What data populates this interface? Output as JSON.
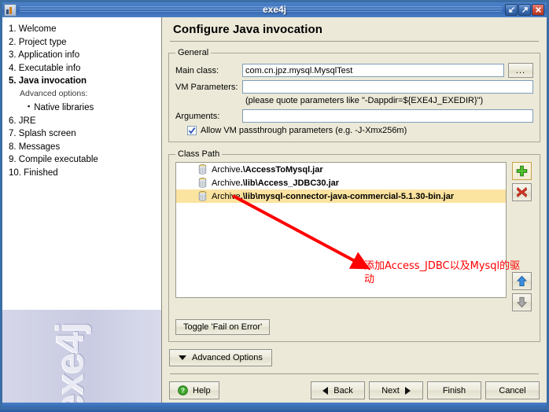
{
  "window": {
    "title": "exe4j",
    "icon": "app-icon",
    "buttons": [
      {
        "name": "minimize",
        "glyph": "minimize-icon"
      },
      {
        "name": "maximize",
        "glyph": "maximize-icon"
      },
      {
        "name": "close",
        "glyph": "close-icon"
      }
    ]
  },
  "sidebar": {
    "items": [
      {
        "label": "1. Welcome",
        "current": false
      },
      {
        "label": "2. Project type",
        "current": false
      },
      {
        "label": "3. Application info",
        "current": false
      },
      {
        "label": "4. Executable info",
        "current": false
      },
      {
        "label": "5. Java invocation",
        "current": true
      }
    ],
    "advanced_label": "Advanced options:",
    "advanced_items": [
      {
        "label": "Native libraries"
      }
    ],
    "items_after": [
      {
        "label": "6. JRE",
        "current": false
      },
      {
        "label": "7. Splash screen",
        "current": false
      },
      {
        "label": "8. Messages",
        "current": false
      },
      {
        "label": "9. Compile executable",
        "current": false
      },
      {
        "label": "10. Finished",
        "current": false
      }
    ],
    "watermark": "exe4j"
  },
  "main": {
    "page_title": "Configure Java invocation",
    "general": {
      "legend": "General",
      "main_class_label": "Main class:",
      "main_class_value": "com.cn.jpz.mysql.MysqlTest",
      "browse_label": "...",
      "vm_params_label": "VM Parameters:",
      "vm_params_value": "",
      "vm_params_hint": "(please quote parameters like \"-Dappdir=${EXE4J_EXEDIR}\")",
      "arguments_label": "Arguments:",
      "arguments_value": "",
      "passthrough_label": "Allow VM passthrough parameters (e.g. -J-Xmx256m)",
      "passthrough_checked": true
    },
    "classpath": {
      "legend": "Class Path",
      "entries": [
        {
          "kind": "Archive ",
          "path": ".\\AccessToMysql.jar",
          "selected": false,
          "icon": "jar-icon"
        },
        {
          "kind": "Archive ",
          "path": ".\\lib\\Access_JDBC30.jar",
          "selected": false,
          "icon": "jar-icon"
        },
        {
          "kind": "Archive ",
          "path": ".\\lib\\mysql-connector-java-commercial-5.1.30-bin.jar",
          "selected": true,
          "icon": "jar-icon"
        }
      ],
      "side_buttons": [
        {
          "name": "add",
          "icon": "plus-icon",
          "highlighted": true
        },
        {
          "name": "remove",
          "icon": "x-icon",
          "highlighted": false
        },
        {
          "name": "move-up",
          "icon": "arrow-up-icon",
          "highlighted": false
        },
        {
          "name": "move-down",
          "icon": "arrow-down-icon",
          "highlighted": false
        }
      ],
      "toggle_label": "Toggle 'Fail on Error'"
    },
    "advanced_options_label": "Advanced Options",
    "footer": {
      "help_label": "Help",
      "back_label": "Back",
      "next_label": "Next",
      "finish_label": "Finish",
      "cancel_label": "Cancel"
    }
  },
  "annotation": {
    "text": "添加Access_JDBC以及Mysql的驱动",
    "color": "#ff0000"
  },
  "colors": {
    "titlebar": "#3d72bd",
    "panel": "#ece9d8",
    "selection": "#fbe3a0",
    "field_border": "#7f9db9",
    "annotation": "#ff0000"
  }
}
